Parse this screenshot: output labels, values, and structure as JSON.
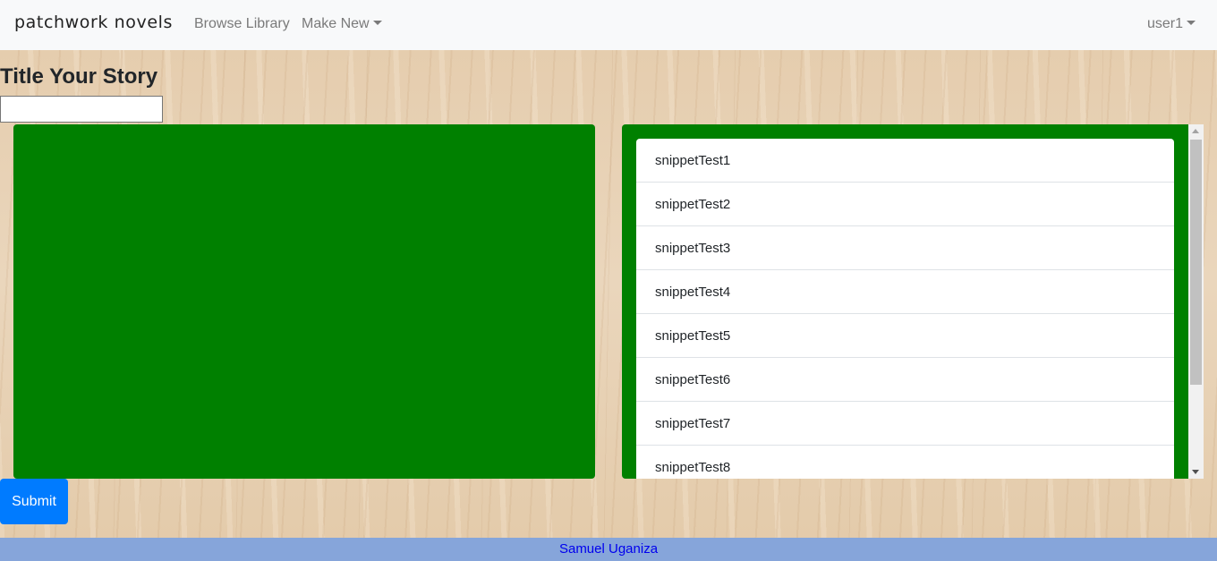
{
  "navbar": {
    "brand": "patchwork novels",
    "browse_label": "Browse Library",
    "make_new_label": "Make New",
    "user_label": "user1"
  },
  "editor": {
    "title_heading": "Title Your Story",
    "title_value": "",
    "submit_label": "Submit"
  },
  "snippets": {
    "items": [
      {
        "label": "snippetTest1"
      },
      {
        "label": "snippetTest2"
      },
      {
        "label": "snippetTest3"
      },
      {
        "label": "snippetTest4"
      },
      {
        "label": "snippetTest5"
      },
      {
        "label": "snippetTest6"
      },
      {
        "label": "snippetTest7"
      },
      {
        "label": "snippetTest8"
      }
    ]
  },
  "footer": {
    "author": "Samuel Uganiza"
  },
  "colors": {
    "panel_green": "#008000",
    "submit_blue": "#007bff",
    "footer_bg": "#86a5da",
    "footer_link": "#0000ee"
  },
  "icons": {
    "dropdown": "caret-down-icon",
    "scroll_up": "scroll-up-arrow-icon",
    "scroll_down": "scroll-down-arrow-icon"
  }
}
